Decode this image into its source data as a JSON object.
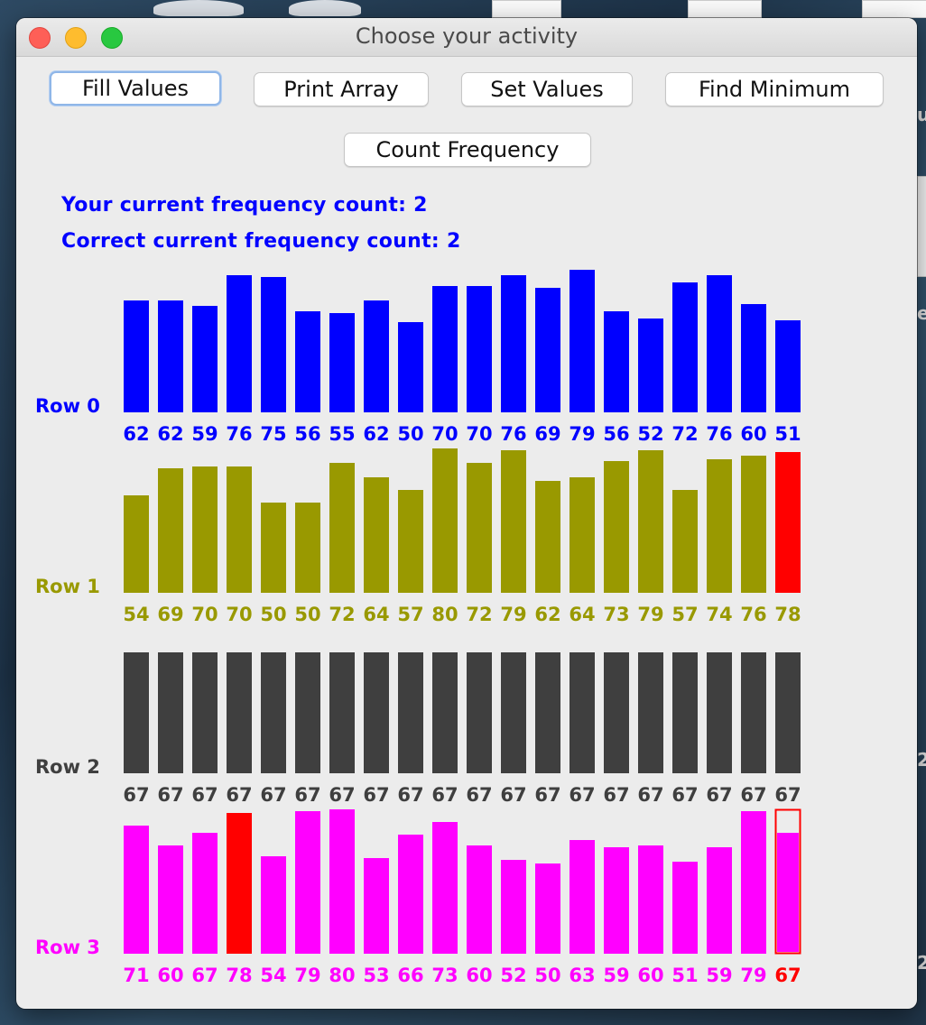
{
  "window": {
    "title": "Choose your activity"
  },
  "buttons": {
    "fill": "Fill Values",
    "print": "Print Array",
    "set": "Set Values",
    "min": "Find Minimum",
    "count": "Count Frequency"
  },
  "frequency": {
    "your": "Your current frequency count: 2",
    "correct": "Correct current frequency count: 2"
  },
  "colors": {
    "row0": "#0000ff",
    "row1": "#999900",
    "row2": "#3f3f3f",
    "row3": "#ff00ff",
    "highlight": "#ff0000"
  },
  "chart_data": {
    "type": "bar",
    "rows": [
      {
        "label": "Row 0",
        "values": [
          62,
          62,
          59,
          76,
          75,
          56,
          55,
          62,
          50,
          70,
          70,
          76,
          69,
          79,
          56,
          52,
          72,
          76,
          60,
          51
        ],
        "highlight": []
      },
      {
        "label": "Row 1",
        "values": [
          54,
          69,
          70,
          70,
          50,
          50,
          72,
          64,
          57,
          80,
          72,
          79,
          62,
          64,
          73,
          79,
          57,
          74,
          76,
          78
        ],
        "highlight": [
          19
        ]
      },
      {
        "label": "Row 2",
        "values": [
          67,
          67,
          67,
          67,
          67,
          67,
          67,
          67,
          67,
          67,
          67,
          67,
          67,
          67,
          67,
          67,
          67,
          67,
          67,
          67
        ],
        "highlight": []
      },
      {
        "label": "Row 3",
        "values": [
          71,
          60,
          67,
          78,
          54,
          79,
          80,
          53,
          66,
          73,
          60,
          52,
          50,
          63,
          59,
          60,
          51,
          59,
          79,
          67
        ],
        "highlight": [
          3
        ],
        "outlined": [
          19
        ]
      }
    ]
  }
}
